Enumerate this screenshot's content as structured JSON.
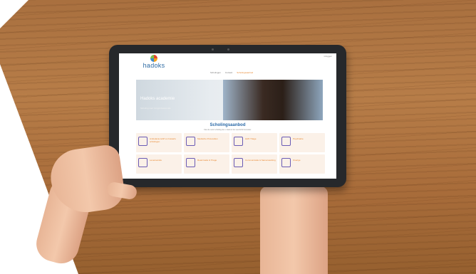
{
  "site": {
    "logo_text": "hadoks",
    "top_link": "inloggen",
    "nav": [
      {
        "label": "Scholingen",
        "active": false
      },
      {
        "label": "Contact",
        "active": false
      },
      {
        "label": "Scholingsaanbod",
        "active": true
      }
    ],
    "hero": {
      "title": "Hadoks academie",
      "subtitle": "Scholing voor zorgprofessionals"
    },
    "section_title": "Scholingsaanbod",
    "section_subtitle": "Kies de soort scholing die u zoekt in het overzicht hieronder.",
    "cards": [
      {
        "label": "Ambulante HAP en huisarts scholingen",
        "icon": "doctor-icon"
      },
      {
        "label": "Medische Protocollen",
        "icon": "ambulance-icon"
      },
      {
        "label": "HAP-Triage",
        "icon": "stethoscope-icon"
      },
      {
        "label": "Psychiatrie",
        "icon": "head-icon"
      },
      {
        "label": "Levenseinde",
        "icon": "brain-icon"
      },
      {
        "label": "Reanimatie & Triage",
        "icon": "first-aid-icon"
      },
      {
        "label": "Communicatie & Samenwerking",
        "icon": "book-icon"
      },
      {
        "label": "Overige",
        "icon": "medical-icon"
      }
    ]
  },
  "colors": {
    "brand_blue": "#2b6aa8",
    "accent_orange": "#e8872f",
    "icon_purple": "#6a5bb5",
    "card_bg": "#fbf1e8"
  }
}
